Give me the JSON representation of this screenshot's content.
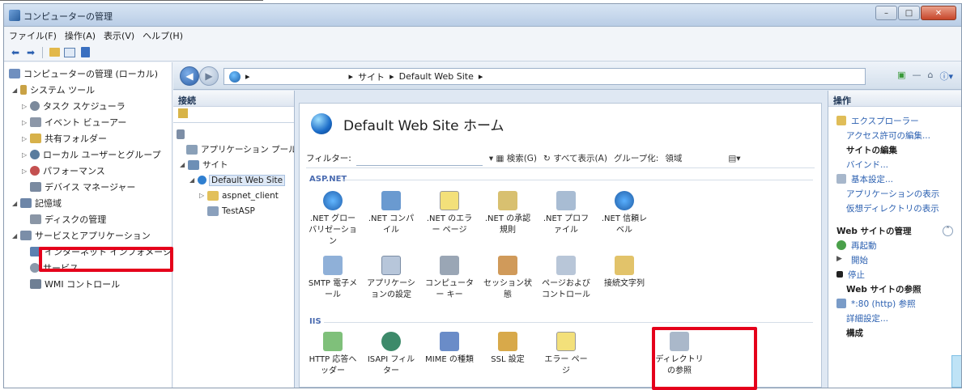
{
  "window": {
    "title": "コンピューターの管理"
  },
  "menu": [
    "ファイル(F)",
    "操作(A)",
    "表示(V)",
    "ヘルプ(H)"
  ],
  "tree": {
    "root": "コンピューターの管理 (ローカル)",
    "system_tools": "システム ツール",
    "task_scheduler": "タスク スケジューラ",
    "event_viewer": "イベント ビューアー",
    "shared_folders": "共有フォルダー",
    "local_users": "ローカル ユーザーとグループ",
    "performance": "パフォーマンス",
    "device_manager": "デバイス マネージャー",
    "storage": "記憶域",
    "disk_management": "ディスクの管理",
    "services_apps": "サービスとアプリケーション",
    "iis_manager": "インターネット インフォメーション",
    "services": "サービス",
    "wmi": "WMI コントロール"
  },
  "address": {
    "crumb1": "サイト",
    "crumb2": "Default Web Site"
  },
  "connections": {
    "header": "接続",
    "app_pools": "アプリケーション プール",
    "sites": "サイト",
    "default_site": "Default Web Site",
    "aspnet_client": "aspnet_client",
    "testasp": "TestASP"
  },
  "center": {
    "title": "Default Web Site ホーム",
    "filter_label": "フィルター:",
    "search": "検索(G)",
    "show_all": "すべて表示(A)",
    "group_by": "グループ化:",
    "group_value": "領域",
    "section_aspnet": "ASP.NET",
    "section_iis": "IIS",
    "features_aspnet_row1": [
      ".NET グローバリゼーション",
      ".NET コンパイル",
      ".NET のエラー ページ",
      ".NET の承認規則",
      ".NET プロファイル",
      ".NET 信頼レベル"
    ],
    "features_aspnet_row2": [
      "SMTP 電子メール",
      "アプリケーションの設定",
      "コンピューター キー",
      "セッション状態",
      "ページおよびコントロール",
      "接続文字列"
    ],
    "features_iis": [
      "HTTP 応答ヘッダー",
      "ISAPI フィルター",
      "MIME の種類",
      "SSL 設定",
      "エラー ページ",
      "ディレクトリの参照"
    ]
  },
  "actions": {
    "header": "操作",
    "explore": "エクスプローラー",
    "edit_permissions": "アクセス許可の編集...",
    "edit_site": "サイトの編集",
    "bindings": "バインド...",
    "basic_settings": "基本設定...",
    "view_apps": "アプリケーションの表示",
    "view_vdirs": "仮想ディレクトリの表示",
    "manage_site": "Web サイトの管理",
    "restart": "再起動",
    "start": "開始",
    "stop": "停止",
    "browse_site": "Web サイトの参照",
    "browse_80": "*:80 (http) 参照",
    "advanced": "詳細設定...",
    "config": "構成"
  },
  "colors": {
    "highlight": "#e5001b",
    "link": "#2a5fb0"
  }
}
